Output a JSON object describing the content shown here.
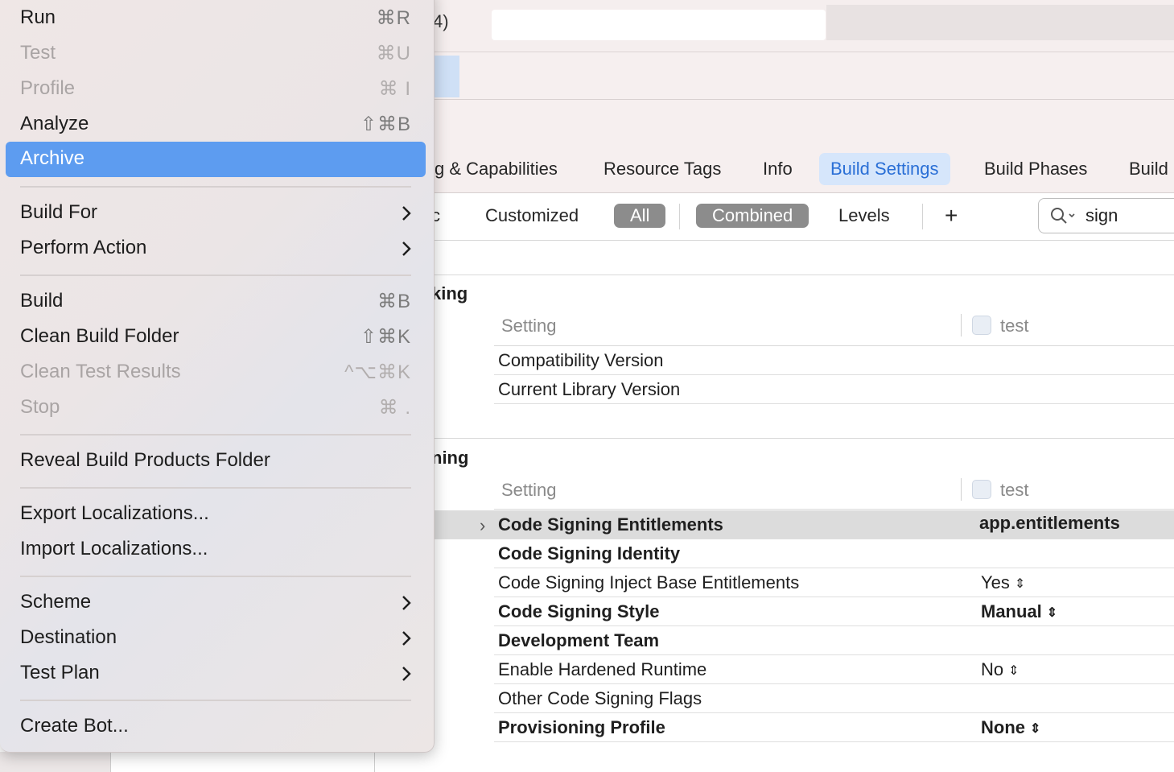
{
  "menu": {
    "items": [
      {
        "label": "Run",
        "shortcut": "⌘R",
        "enabled": true
      },
      {
        "label": "Test",
        "shortcut": "⌘U",
        "enabled": false
      },
      {
        "label": "Profile",
        "shortcut": "⌘ I",
        "enabled": false
      },
      {
        "label": "Analyze",
        "shortcut": "⇧⌘B",
        "enabled": true
      },
      {
        "label": "Archive",
        "shortcut": "",
        "enabled": true,
        "selected": true
      },
      {
        "label": "Build For",
        "submenu": true
      },
      {
        "label": "Perform Action",
        "submenu": true
      },
      {
        "label": "Build",
        "shortcut": "⌘B",
        "enabled": true
      },
      {
        "label": "Clean Build Folder",
        "shortcut": "⇧⌘K",
        "enabled": true
      },
      {
        "label": "Clean Test Results",
        "shortcut": "^⌥⌘K",
        "enabled": false
      },
      {
        "label": "Stop",
        "shortcut": "⌘ .",
        "enabled": false
      },
      {
        "label": "Reveal Build Products Folder",
        "shortcut": ""
      },
      {
        "label": "Export Localizations...",
        "shortcut": ""
      },
      {
        "label": "Import Localizations...",
        "shortcut": ""
      },
      {
        "label": "Scheme",
        "submenu": true
      },
      {
        "label": "Destination",
        "submenu": true
      },
      {
        "label": "Test Plan",
        "submenu": true
      },
      {
        "label": "Create Bot...",
        "shortcut": ""
      }
    ]
  },
  "toolbar": {
    "title_fragment": "4)"
  },
  "tabs": [
    "g & Capabilities",
    "Resource Tags",
    "Info",
    "Build Settings",
    "Build Phases",
    "Build"
  ],
  "active_tab": "Build Settings",
  "filter": {
    "partial": "c",
    "customized": "Customized",
    "all": "All",
    "combined": "Combined",
    "levels": "Levels",
    "add": "+",
    "search_value": "sign"
  },
  "sections": [
    {
      "title": "king",
      "col_setting": "Setting",
      "col_target": "test",
      "rows": [
        {
          "name": "Compatibility Version",
          "value": ""
        },
        {
          "name": "Current Library Version",
          "value": ""
        }
      ]
    },
    {
      "title": "ning",
      "col_setting": "Setting",
      "col_target": "test",
      "rows": [
        {
          "name": "Code Signing Entitlements",
          "value": "app.entitlements"
        },
        {
          "name": "Code Signing Identity",
          "value": ""
        },
        {
          "name": "Code Signing Inject Base Entitlements",
          "value": "Yes"
        },
        {
          "name": "Code Signing Style",
          "value": "Manual"
        },
        {
          "name": "Development Team",
          "value": ""
        },
        {
          "name": "Enable Hardened Runtime",
          "value": "No"
        },
        {
          "name": "Other Code Signing Flags",
          "value": ""
        },
        {
          "name": "Provisioning Profile",
          "value": "None"
        }
      ]
    }
  ],
  "icons": {
    "disclosure": ">",
    "stepper": "⌃⌄",
    "search": "magnifier-with-chevron"
  }
}
